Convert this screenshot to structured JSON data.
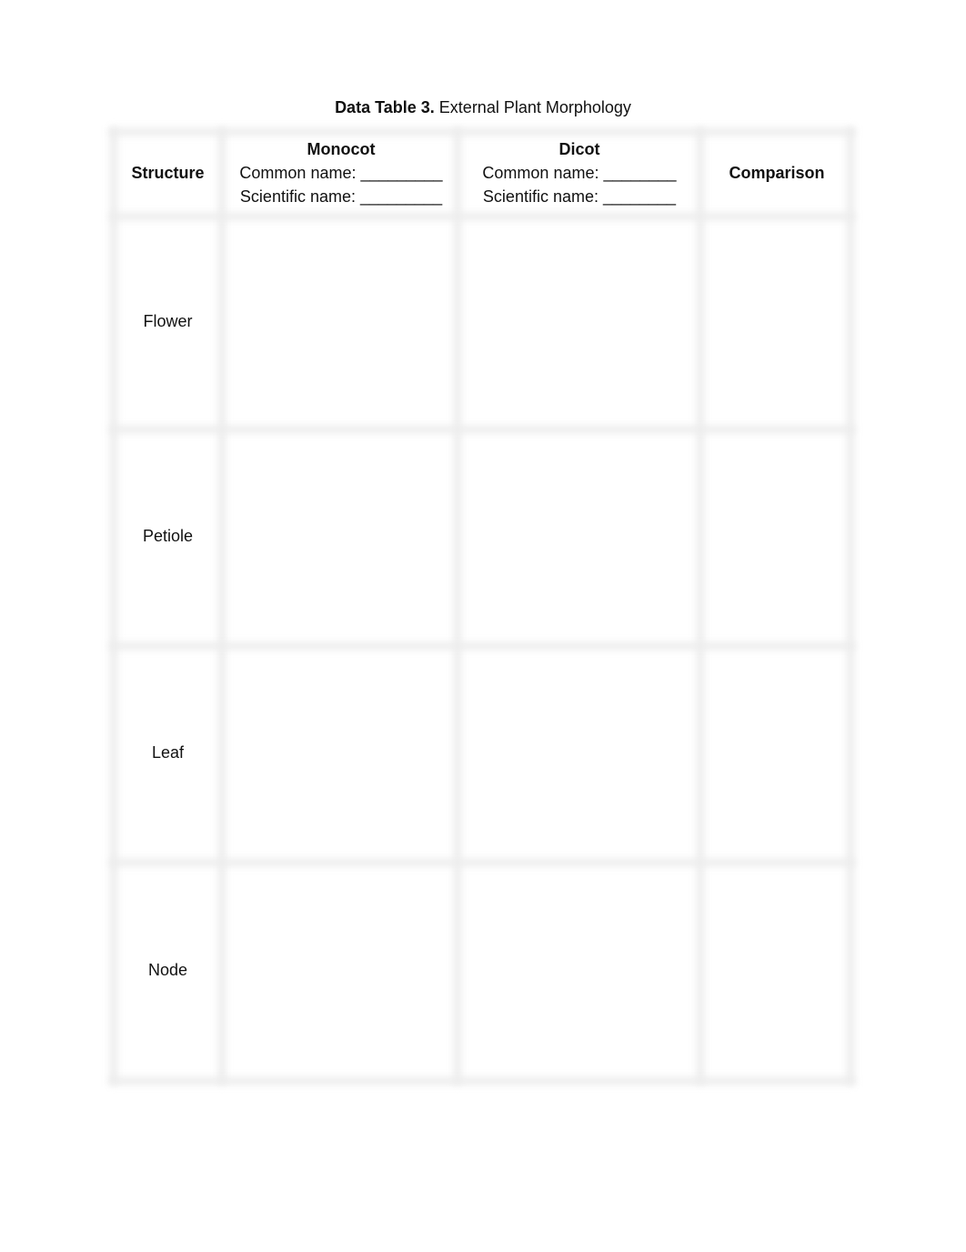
{
  "caption": {
    "label": "Data Table 3.",
    "title": "External Plant Morphology"
  },
  "table": {
    "headers": {
      "structure": "Structure",
      "monocot": {
        "title": "Monocot",
        "common_name": "Common name: _________",
        "scientific_name": "Scientific name: _________"
      },
      "dicot": {
        "title": "Dicot",
        "common_name": "Common name: ________",
        "scientific_name": "Scientific name: ________"
      },
      "comparison": "Comparison"
    },
    "rows": [
      {
        "structure": "Flower",
        "monocot": "",
        "dicot": "",
        "comparison": ""
      },
      {
        "structure": "Petiole",
        "monocot": "",
        "dicot": "",
        "comparison": ""
      },
      {
        "structure": "Leaf",
        "monocot": "",
        "dicot": "",
        "comparison": ""
      },
      {
        "structure": "Node",
        "monocot": "",
        "dicot": "",
        "comparison": ""
      }
    ]
  }
}
